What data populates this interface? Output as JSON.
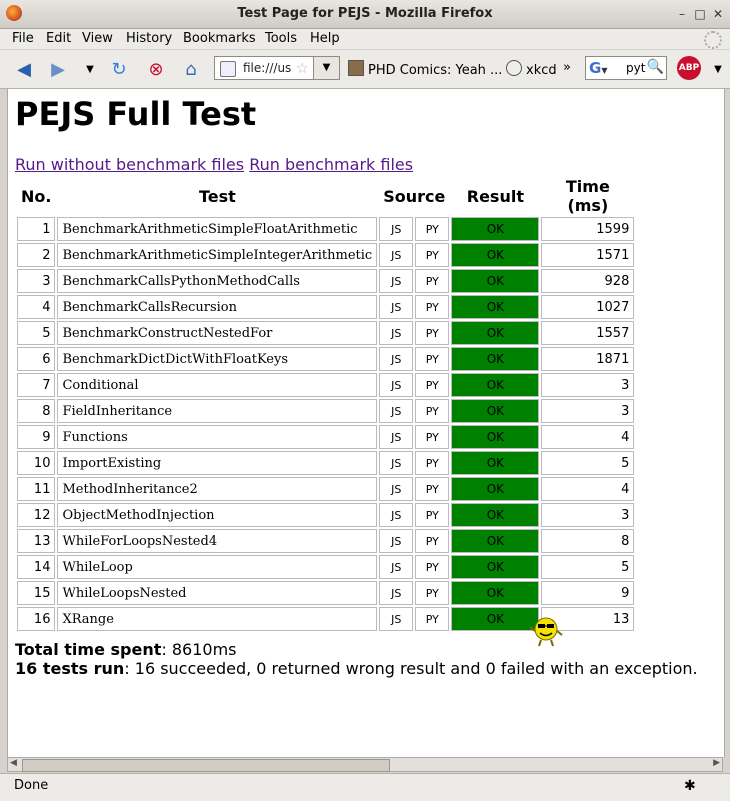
{
  "window": {
    "title": "Test Page for PEJS - Mozilla Firefox"
  },
  "menu": [
    "File",
    "Edit",
    "View",
    "History",
    "Bookmarks",
    "Tools",
    "Help"
  ],
  "nav": {
    "url": "file:///us",
    "search_value": "pyth"
  },
  "bookmarks": [
    "PHD Comics: Yeah ...",
    "xkcd",
    "»"
  ],
  "page": {
    "heading": "PEJS Full Test",
    "link_no_bench": "Run without benchmark files",
    "link_bench": "Run benchmark files",
    "headers": {
      "no": "No.",
      "test": "Test",
      "source": "Source",
      "result": "Result",
      "time": "Time (ms)"
    },
    "rows": [
      {
        "no": "1",
        "name": "BenchmarkArithmeticSimpleFloatArithmetic",
        "js": "JS",
        "py": "PY",
        "result": "OK",
        "time": "1599"
      },
      {
        "no": "2",
        "name": "BenchmarkArithmeticSimpleIntegerArithmetic",
        "js": "JS",
        "py": "PY",
        "result": "OK",
        "time": "1571"
      },
      {
        "no": "3",
        "name": "BenchmarkCallsPythonMethodCalls",
        "js": "JS",
        "py": "PY",
        "result": "OK",
        "time": "928"
      },
      {
        "no": "4",
        "name": "BenchmarkCallsRecursion",
        "js": "JS",
        "py": "PY",
        "result": "OK",
        "time": "1027"
      },
      {
        "no": "5",
        "name": "BenchmarkConstructNestedFor",
        "js": "JS",
        "py": "PY",
        "result": "OK",
        "time": "1557"
      },
      {
        "no": "6",
        "name": "BenchmarkDictDictWithFloatKeys",
        "js": "JS",
        "py": "PY",
        "result": "OK",
        "time": "1871"
      },
      {
        "no": "7",
        "name": "Conditional",
        "js": "JS",
        "py": "PY",
        "result": "OK",
        "time": "3"
      },
      {
        "no": "8",
        "name": "FieldInheritance",
        "js": "JS",
        "py": "PY",
        "result": "OK",
        "time": "3"
      },
      {
        "no": "9",
        "name": "Functions",
        "js": "JS",
        "py": "PY",
        "result": "OK",
        "time": "4"
      },
      {
        "no": "10",
        "name": "ImportExisting",
        "js": "JS",
        "py": "PY",
        "result": "OK",
        "time": "5"
      },
      {
        "no": "11",
        "name": "MethodInheritance2",
        "js": "JS",
        "py": "PY",
        "result": "OK",
        "time": "4"
      },
      {
        "no": "12",
        "name": "ObjectMethodInjection",
        "js": "JS",
        "py": "PY",
        "result": "OK",
        "time": "3"
      },
      {
        "no": "13",
        "name": "WhileForLoopsNested4",
        "js": "JS",
        "py": "PY",
        "result": "OK",
        "time": "8"
      },
      {
        "no": "14",
        "name": "WhileLoop",
        "js": "JS",
        "py": "PY",
        "result": "OK",
        "time": "5"
      },
      {
        "no": "15",
        "name": "WhileLoopsNested",
        "js": "JS",
        "py": "PY",
        "result": "OK",
        "time": "9"
      },
      {
        "no": "16",
        "name": "XRange",
        "js": "JS",
        "py": "PY",
        "result": "OK",
        "time": "13"
      }
    ],
    "summary": {
      "time_label": "Total time spent",
      "time_value": ": 8610ms",
      "tests_label": "16 tests run",
      "tests_value": ": 16 succeeded, 0 returned wrong result and 0 failed with an exception."
    }
  },
  "status": {
    "text": "Done"
  },
  "colors": {
    "ok_green": "#008000",
    "link": "#551a8b"
  }
}
